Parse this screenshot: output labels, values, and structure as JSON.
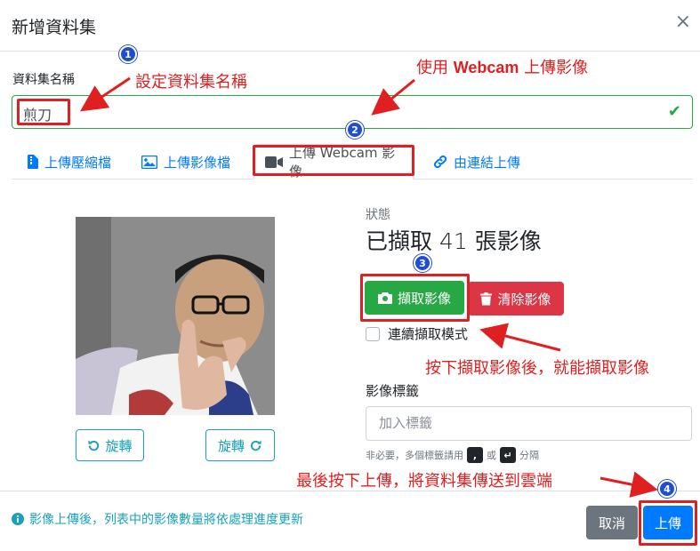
{
  "dialog": {
    "title": "新增資料集",
    "close_icon": "×"
  },
  "dataset_name": {
    "label": "資料集名稱",
    "value": "煎刀"
  },
  "tabs": [
    {
      "label": "上傳壓縮檔",
      "icon": "file-archive-icon"
    },
    {
      "label": "上傳影像檔",
      "icon": "image-icon"
    },
    {
      "label": "上傳 Webcam 影像",
      "icon": "video-icon"
    },
    {
      "label": "由連結上傳",
      "icon": "link-icon"
    }
  ],
  "preview": {
    "rotate_left_label": "旋轉",
    "rotate_right_label": "旋轉"
  },
  "status": {
    "label": "狀態",
    "value": "已擷取 41 張影像"
  },
  "actions": {
    "capture_label": "擷取影像",
    "clear_label": "清除影像"
  },
  "continuous_mode": {
    "label": "連續擷取模式",
    "checked": false
  },
  "tags": {
    "label": "影像標籤",
    "placeholder": "加入標籤",
    "hint_prefix": "非必要，多個標籤請用",
    "hint_key1": ",",
    "hint_or": "或",
    "hint_key2": "↵",
    "hint_suffix": "分隔"
  },
  "footer": {
    "info": "影像上傳後，列表中的影像數量將依處理進度更新",
    "cancel_label": "取消",
    "upload_label": "上傳"
  },
  "annotations": {
    "step1_badge": "1",
    "step1_text": "設定資料集名稱",
    "step2_badge": "2",
    "step2_text_prefix": "使用",
    "step2_text_bold": "Webcam",
    "step2_text_suffix": "上傳影像",
    "step3_badge": "3",
    "step3_text": "按下擷取影像後，就能擷取影像",
    "step4_badge": "4",
    "step4_text": "最後按下上傳，將資料集傳送到雲端"
  },
  "colors": {
    "primary": "#007bff",
    "success": "#28a745",
    "danger": "#dc3545",
    "info": "#17a2b8",
    "secondary": "#6c757d",
    "annotation_red": "#e02020",
    "badge_blue": "#1f4fd0"
  }
}
